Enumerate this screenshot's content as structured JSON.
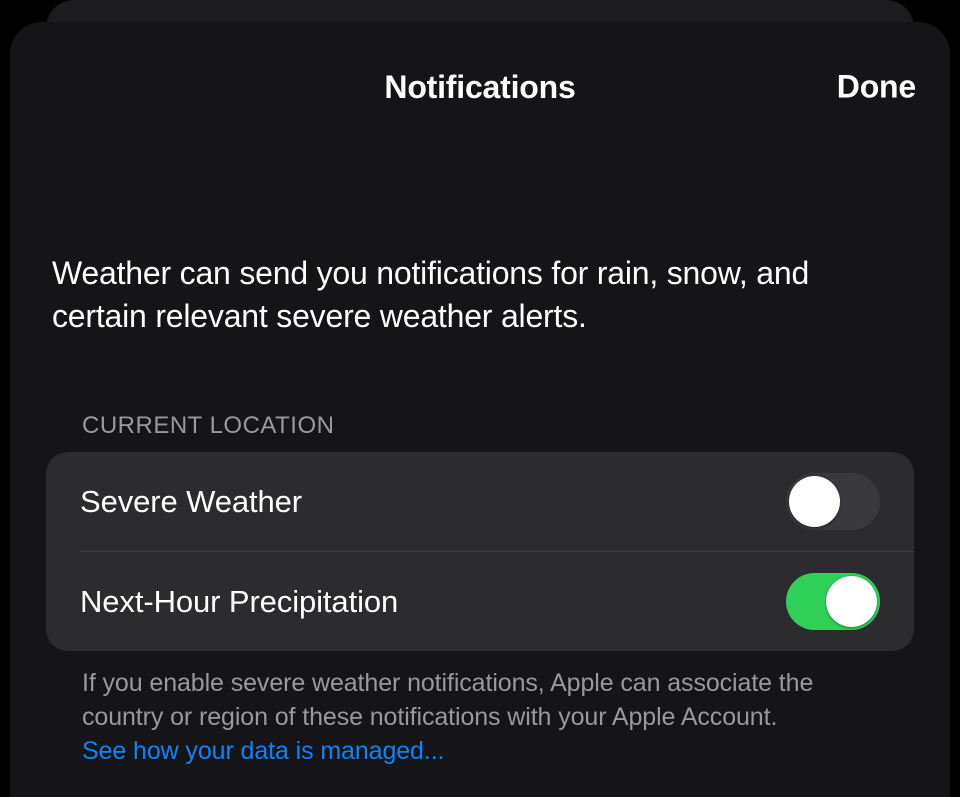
{
  "nav": {
    "title": "Notifications",
    "done": "Done"
  },
  "intro": "Weather can send you notifications for rain, snow, and certain relevant severe weather alerts.",
  "section": {
    "header": "CURRENT LOCATION",
    "rows": [
      {
        "label": "Severe Weather",
        "on": false
      },
      {
        "label": "Next-Hour Precipitation",
        "on": true
      }
    ],
    "footer_text": "If you enable severe weather notifications, Apple can associate the country or region of these notifications with your Apple Account. ",
    "footer_link": "See how your data is managed..."
  },
  "colors": {
    "toggle_on": "#30d158",
    "toggle_off": "#39393d",
    "link": "#0b84ff"
  }
}
